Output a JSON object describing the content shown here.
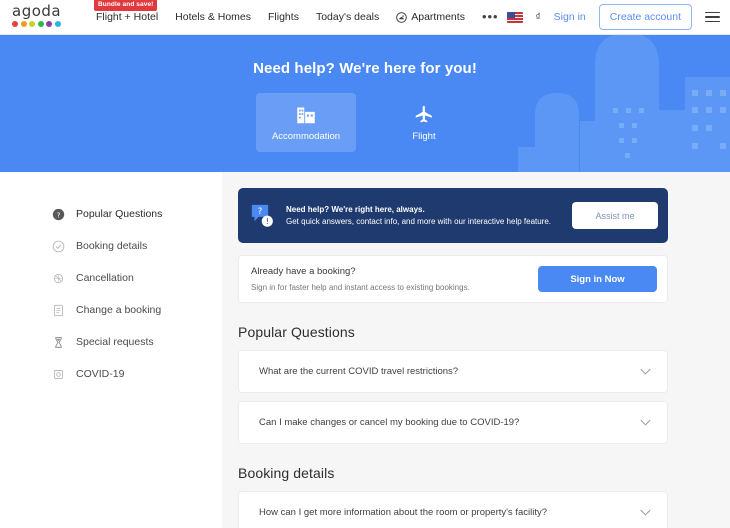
{
  "header": {
    "logo_text": "agoda",
    "logo_dot_colors": [
      "#e8413a",
      "#f59b1c",
      "#c9d42a",
      "#34b44a",
      "#8a3fa0",
      "#29b4e3"
    ],
    "promo_badge": "Bundle and save!",
    "nav": [
      {
        "label": "Flight + Hotel",
        "icon": "none"
      },
      {
        "label": "Hotels & Homes",
        "icon": "none"
      },
      {
        "label": "Flights",
        "icon": "none"
      },
      {
        "label": "Today's deals",
        "icon": "none"
      },
      {
        "label": "Apartments",
        "icon": "apartment-icon"
      }
    ],
    "more_label": "•••",
    "language_icon": "us-flag-icon",
    "currency": "₫",
    "sign_in": "Sign in",
    "create_account": "Create account",
    "menu_icon": "hamburger-menu-icon"
  },
  "hero": {
    "title": "Need help? We're here for you!",
    "background_color": "#4a89f4",
    "tabs": [
      {
        "label": "Accommodation",
        "icon": "building-icon",
        "active": true
      },
      {
        "label": "Flight",
        "icon": "airplane-icon",
        "active": false
      }
    ]
  },
  "sidebar": {
    "items": [
      {
        "label": "Popular Questions",
        "icon": "question-circle-icon",
        "active": true
      },
      {
        "label": "Booking details",
        "icon": "check-circle-icon",
        "active": false
      },
      {
        "label": "Cancellation",
        "icon": "cancel-circle-icon",
        "active": false
      },
      {
        "label": "Change a booking",
        "icon": "document-icon",
        "active": false
      },
      {
        "label": "Special requests",
        "icon": "hourglass-icon",
        "active": false
      },
      {
        "label": "COVID-19",
        "icon": "virus-icon",
        "active": false
      }
    ]
  },
  "help_banner": {
    "icon": "chat-help-icon",
    "heading": "Need help? We're right here, always.",
    "body": "Get quick answers, contact info, and more with our interactive help feature.",
    "button_label": "Assist me",
    "background_color": "#1e3a6e"
  },
  "booking_card": {
    "title": "Already have a booking?",
    "subtitle": "Sign in for faster help and instant access to existing bookings.",
    "button_label": "Sign in Now",
    "button_color": "#4a89f4"
  },
  "sections": [
    {
      "title": "Popular Questions",
      "questions": [
        "What are the current COVID travel restrictions?",
        "Can I make changes or cancel my booking due to COVID-19?"
      ]
    },
    {
      "title": "Booking details",
      "questions": [
        "How can I get more information about the room or property's facility?"
      ]
    }
  ]
}
